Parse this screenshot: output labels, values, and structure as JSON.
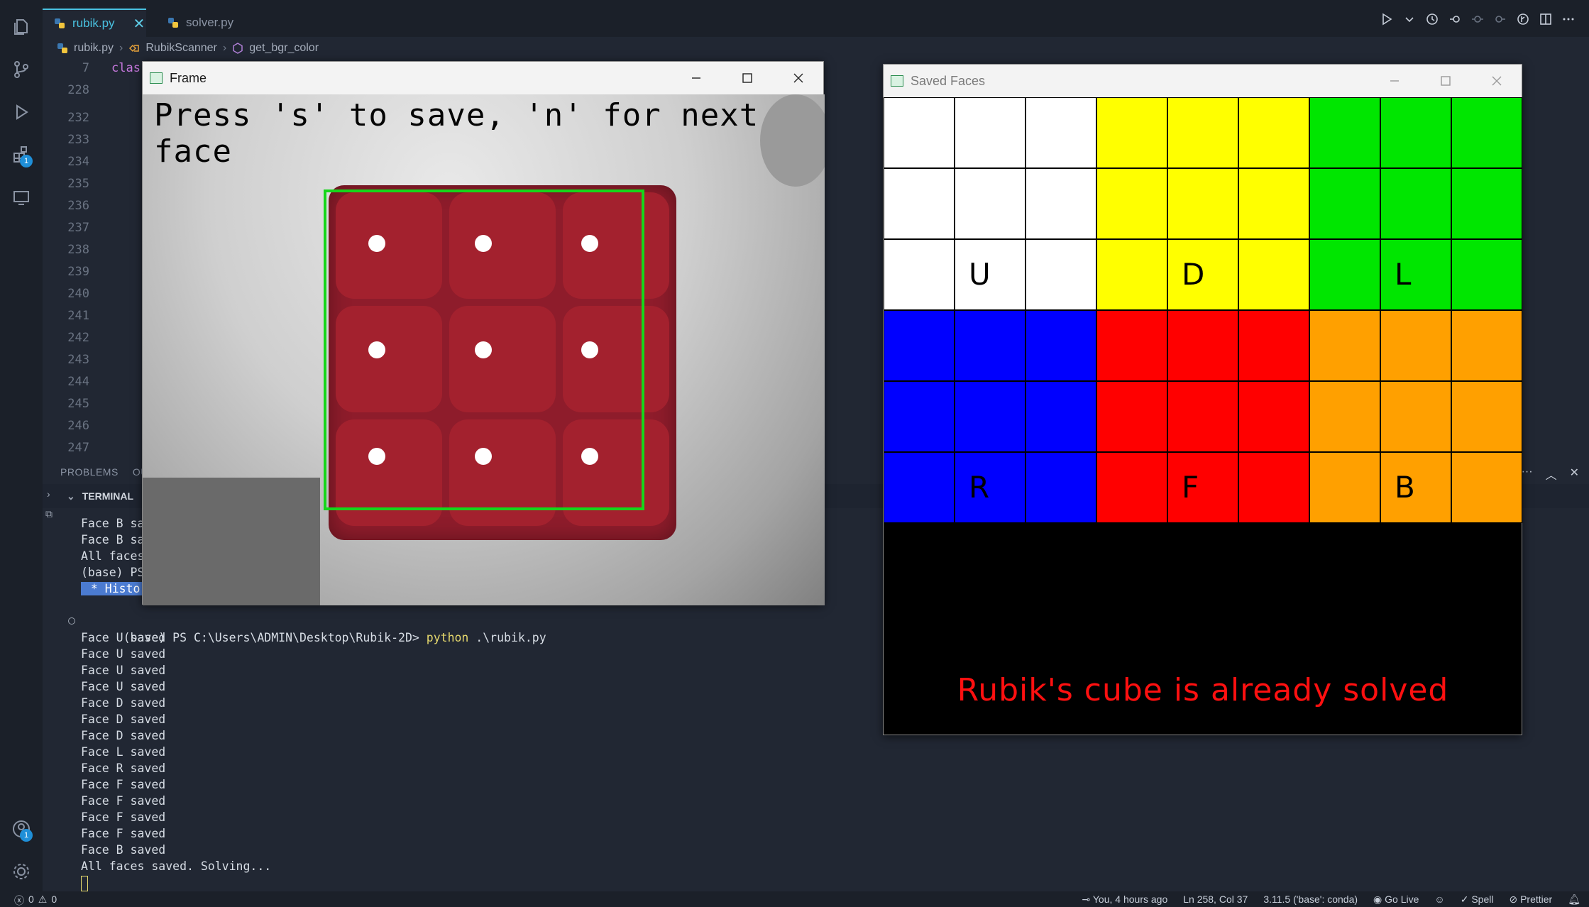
{
  "tabs": [
    {
      "label": "rubik.py",
      "active": true
    },
    {
      "label": "solver.py",
      "active": false
    }
  ],
  "breadcrumb": [
    "rubik.py",
    "RubikScanner",
    "get_bgr_color"
  ],
  "editor": {
    "line_numbers": [
      "7",
      "228",
      "232",
      "233",
      "234",
      "235",
      "236",
      "237",
      "238",
      "239",
      "240",
      "241",
      "242",
      "243",
      "244",
      "245",
      "246",
      "247"
    ],
    "code_fragment": "clas"
  },
  "activity_badges": {
    "extensions": "1",
    "accounts": "1"
  },
  "panel": {
    "tabs": [
      "PROBLEMS",
      "OU"
    ],
    "terminal_label": "TERMINAL"
  },
  "terminal": {
    "top_lines": [
      "Face B sa",
      "Face B sa",
      "All faces",
      "(base) PS"
    ],
    "history_label": " * Histo",
    "prompt": "(base) PS C:\\Users\\ADMIN\\Desktop\\Rubik-2D> ",
    "command": "python",
    "command_arg": " .\\rubik.py",
    "output": [
      "Face U saved",
      "Face U saved",
      "Face U saved",
      "Face U saved",
      "Face D saved",
      "Face D saved",
      "Face D saved",
      "Face L saved",
      "Face R saved",
      "Face F saved",
      "Face F saved",
      "Face F saved",
      "Face F saved",
      "Face B saved",
      "All faces saved. Solving..."
    ]
  },
  "statusbar": {
    "errors": "0",
    "warnings": "0",
    "blame": "You, 4 hours ago",
    "position": "Ln 258, Col 37",
    "interpreter": "3.11.5 ('base': conda)",
    "golive": "Go Live",
    "spell": "Spell",
    "prettier": "Prettier"
  },
  "frame_window": {
    "title": "Frame",
    "overlay_text": "Press 's' to save, 'n' for next face",
    "roi_color": "#16d61a",
    "cube_color": "#a3212e"
  },
  "saved_window": {
    "title": "Saved Faces",
    "faces": [
      {
        "label": "U",
        "color": "#ffffff"
      },
      {
        "label": "D",
        "color": "#ffff00"
      },
      {
        "label": "L",
        "color": "#00e600"
      },
      {
        "label": "R",
        "color": "#0000ff"
      },
      {
        "label": "F",
        "color": "#ff0000"
      },
      {
        "label": "B",
        "color": "#ffa000"
      }
    ],
    "message": "Rubik's cube is already solved"
  },
  "colors": {
    "accent": "#49c1e0",
    "background": "#212733",
    "message_red": "#ff1010"
  }
}
